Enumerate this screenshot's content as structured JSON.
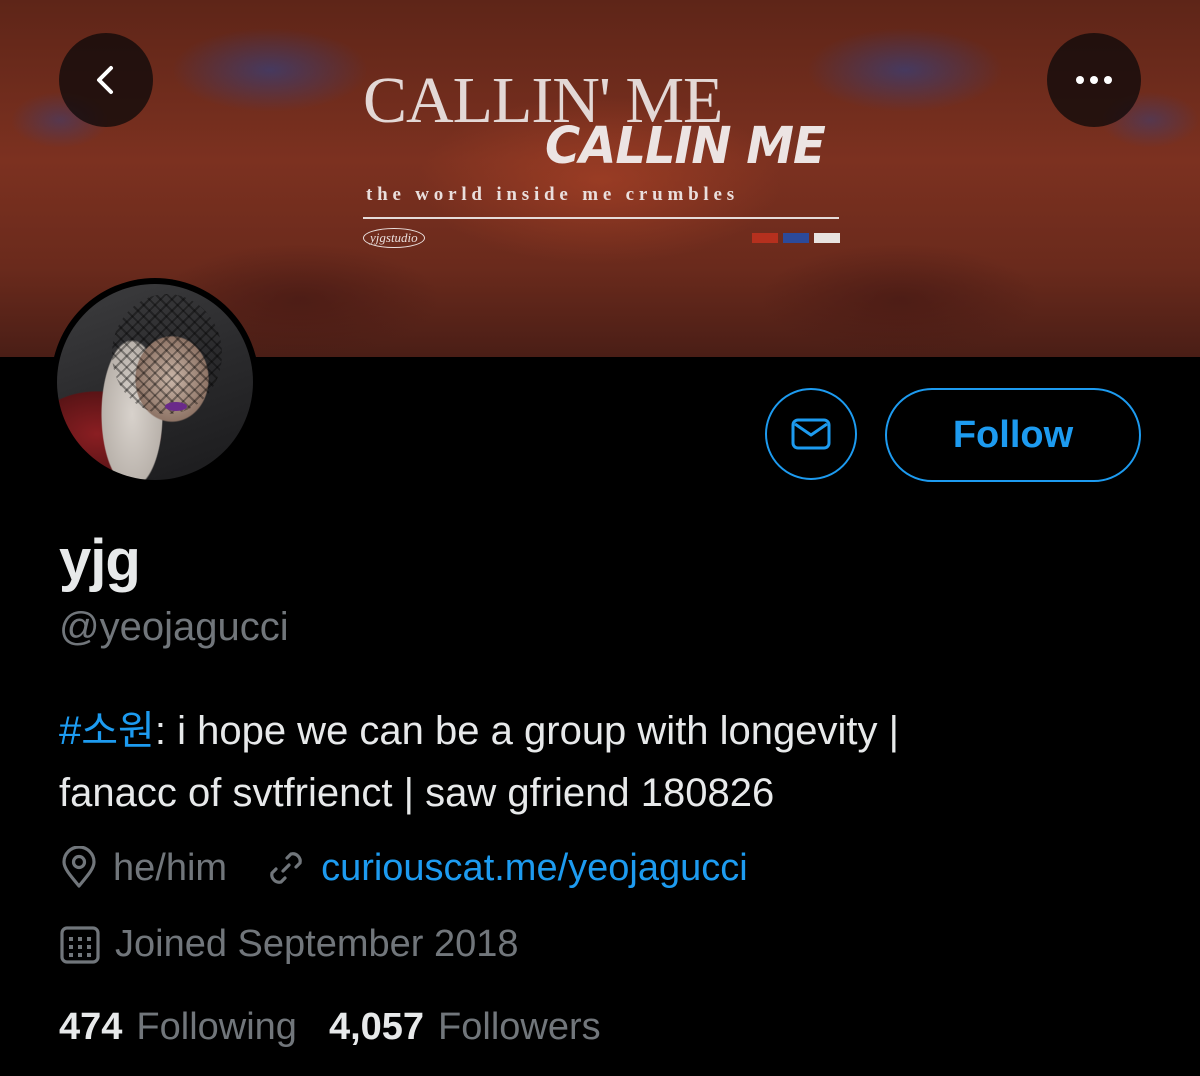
{
  "banner": {
    "title": "CALLIN' ME",
    "subtitle": "CALLIN ME",
    "tagline": "the world inside me crumbles",
    "logo_text": "yjgstudio",
    "swatch_colors": [
      "#b5301e",
      "#2c4a9a",
      "#e8e3e0"
    ]
  },
  "nav": {
    "back_icon": "chevron-left-icon",
    "more_icon": "more-horizontal-icon"
  },
  "profile": {
    "name": "yjg",
    "handle": "@yeojagucci",
    "bio_hashtag": "#소원",
    "bio_line1_rest": ": i hope we can be a group with longevity |",
    "bio_line2": "fanacc of svtfrienct | saw gfriend 180826",
    "location": "he/him",
    "website": "curiouscat.me/yeojagucci",
    "joined": "Joined September 2018",
    "following_count": "474",
    "following_label": "Following",
    "followers_count": "4,057",
    "followers_label": "Followers"
  },
  "actions": {
    "follow_label": "Follow",
    "message_icon": "mail-icon"
  },
  "colors": {
    "accent": "#1d9bf0",
    "secondary_text": "#71767b",
    "primary_text": "#e7e9ea",
    "background": "#000000"
  }
}
